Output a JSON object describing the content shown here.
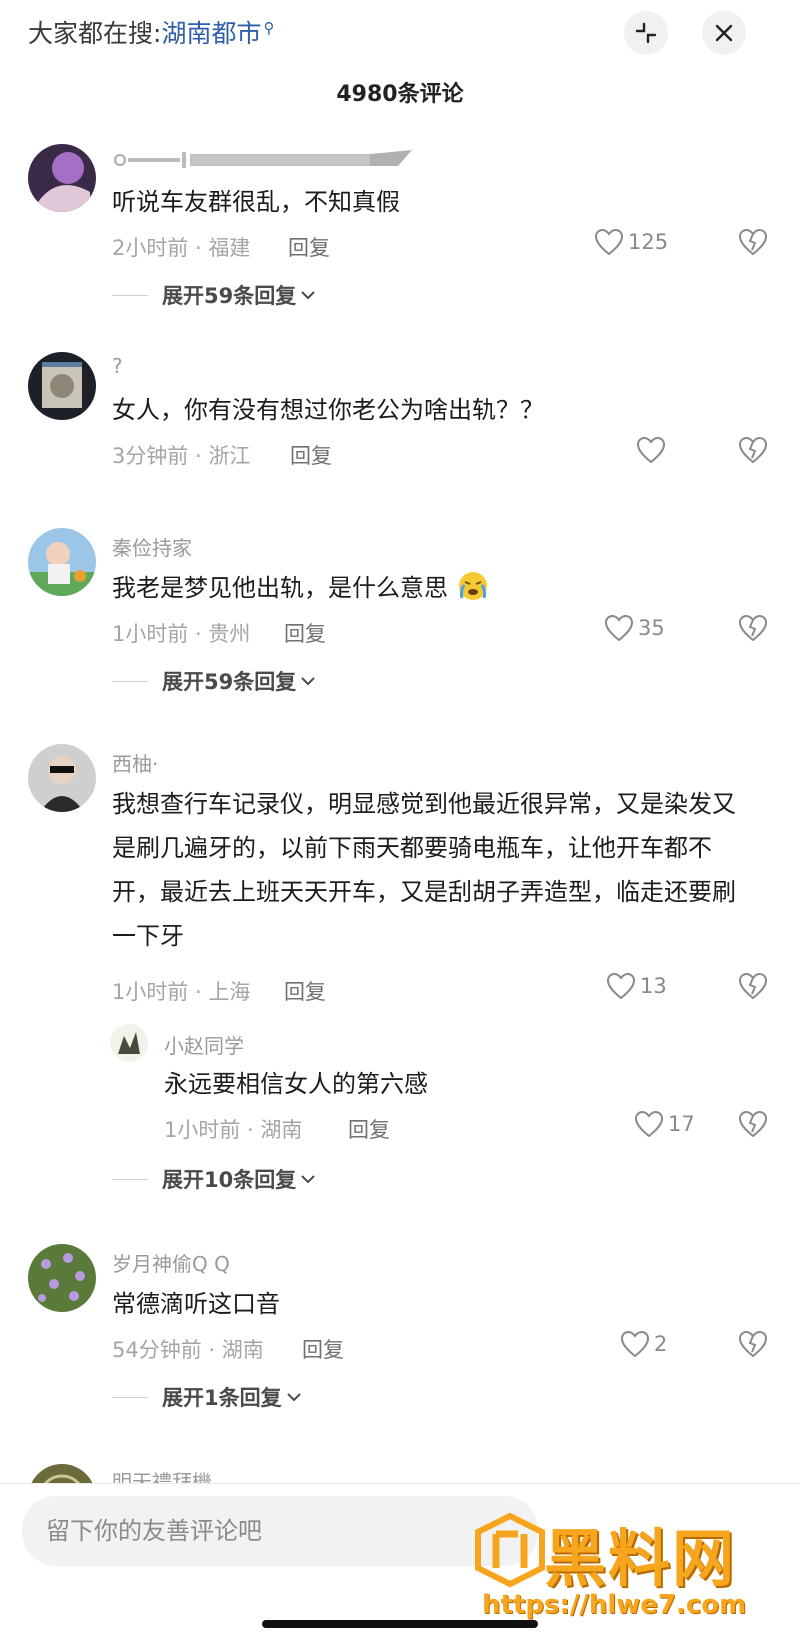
{
  "header": {
    "search_prefix": "大家都在搜:",
    "search_keyword": "湖南都市",
    "comment_count": "4980条评论"
  },
  "comments": [
    {
      "username": "",
      "text": "听说车友群很乱，不知真假",
      "meta": "2小时前 · 福建",
      "reply": "回复",
      "likes": "125",
      "expand": "展开59条回复"
    },
    {
      "username": "?",
      "text": "女人，你有没有想过你老公为啥出轨？？",
      "meta": "3分钟前 · 浙江",
      "reply": "回复",
      "likes": ""
    },
    {
      "username": "秦俭持家",
      "text": "我老是梦见他出轨，是什么意思",
      "meta": "1小时前 · 贵州",
      "reply": "回复",
      "likes": "35",
      "expand": "展开59条回复"
    },
    {
      "username": "西柚·",
      "text": "我想查行车记录仪，明显感觉到他最近很异常，又是染发又是刷几遍牙的，以前下雨天都要骑电瓶车，让他开车都不开，最近去上班天天开车，又是刮胡子弄造型，临走还要刷一下牙",
      "meta": "1小时前 · 上海",
      "reply": "回复",
      "likes": "13",
      "sub_reply": {
        "username": "小赵同学",
        "text": "永远要相信女人的第六感",
        "meta": "1小时前 · 湖南",
        "reply": "回复",
        "likes": "17"
      },
      "expand": "展开10条回复"
    },
    {
      "username": "岁月神偷Q Q",
      "text": "常德滴听这口音",
      "meta": "54分钟前 · 湖南",
      "reply": "回复",
      "likes": "2",
      "expand": "展开1条回复"
    },
    {
      "username": "明天禮拜機"
    }
  ],
  "input": {
    "placeholder": "留下你的友善评论吧"
  },
  "watermark": {
    "title": "黑料网",
    "url": "https://hlwe7.com"
  },
  "colors": {
    "keyword": "#2f5fa8",
    "watermark": "#f7a51c"
  },
  "icons": [
    "search-icon",
    "collapse-icon",
    "close-icon",
    "heart-icon",
    "broken-heart-icon",
    "chevron-down-icon"
  ]
}
